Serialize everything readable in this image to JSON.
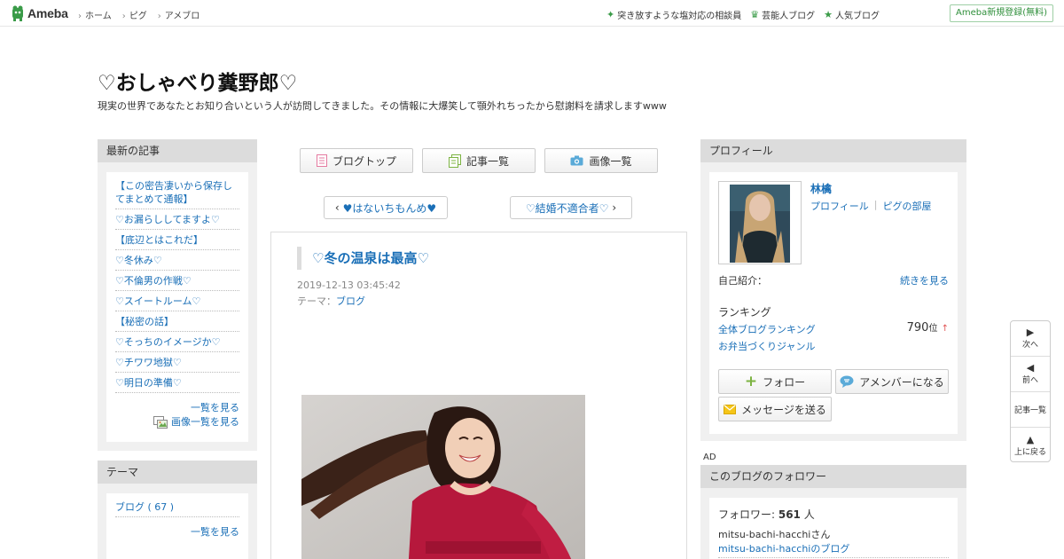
{
  "header": {
    "logo": "Ameba",
    "nav": [
      "ホーム",
      "ピグ",
      "アメブロ"
    ],
    "links": [
      {
        "icon": "sparkle-icon",
        "label": "突き放すような塩対応の相談員"
      },
      {
        "icon": "crown-icon",
        "label": "芸能人ブログ"
      },
      {
        "icon": "star-icon",
        "label": "人気ブログ"
      }
    ],
    "register": "Ameba新規登録(無料)",
    "accent": "#3a9b48"
  },
  "blog": {
    "title": "♡おしゃべり糞野郎♡",
    "description": "現実の世界であなたとお知り合いという人が訪問してきました。その情報に大爆笑して顎外れちったから慰謝料を請求しますwww"
  },
  "latest": {
    "heading": "最新の記事",
    "entries": [
      "【この密告凄いから保存してまとめて通報】",
      "♡お漏らししてますよ♡",
      "【底辺とはこれだ】",
      "♡冬休み♡",
      "♡不倫男の作戦♡",
      "♡スイートルーム♡",
      "【秘密の話】",
      "♡そっちのイメージか♡",
      "♡チワワ地獄♡",
      "♡明日の準備♡"
    ],
    "list_more": "一覧を見る",
    "images_more": "画像一覧を見る"
  },
  "themes": {
    "heading": "テーマ",
    "item": "ブログ ( 67 )",
    "more": "一覧を見る"
  },
  "center": {
    "tabs": [
      {
        "icon": "blog-top-icon",
        "label": "ブログトップ"
      },
      {
        "icon": "entry-list-icon",
        "label": "記事一覧"
      },
      {
        "icon": "camera-icon",
        "label": "画像一覧"
      }
    ],
    "prev": "♥はないちもんめ♥",
    "next": "♡結婚不適合者♡"
  },
  "article": {
    "title": "♡冬の温泉は最高♡",
    "date": "2019-12-13 03:45:42",
    "theme_label": "テーマ：",
    "theme": "ブログ"
  },
  "profile": {
    "heading": "プロフィール",
    "name": "林檎",
    "link_profile": "プロフィール",
    "link_room": "ピグの部屋",
    "intro_label": "自己紹介：",
    "intro_more": "続きを見る",
    "ranking_label": "ランキング",
    "ranking_all": "全体ブログランキング",
    "ranking_genre": "お弁当づくりジャンル",
    "rank": "790",
    "rank_unit": "位",
    "follow": "フォロー",
    "member": "アメンバーになる",
    "message": "メッセージを送る"
  },
  "ad_label": "AD",
  "followers": {
    "heading": "このブログのフォロワー",
    "count_label": "フォロワー: ",
    "count": "561",
    "count_unit": " 人",
    "name": "mitsu-bachi-hacchiさん",
    "blog": "mitsu-bachi-hacchiのブログ"
  },
  "floatnav": {
    "next": "次へ",
    "prev": "前へ",
    "list": "記事一覧",
    "top": "上に戻る"
  }
}
